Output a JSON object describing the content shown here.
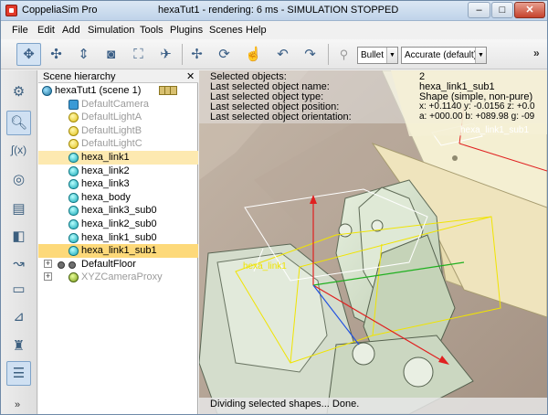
{
  "window": {
    "app_name": "CoppeliaSim Pro",
    "title": "hexaTut1 - rendering: 6 ms - SIMULATION STOPPED",
    "min_label": "–",
    "max_label": "□",
    "close_label": "✕"
  },
  "menu": [
    "File",
    "Edit",
    "Add",
    "Simulation",
    "Tools",
    "Plugins",
    "Scenes",
    "Help"
  ],
  "toolbar": {
    "engine": "Bullet",
    "accuracy": "Accurate (default)",
    "more": "»"
  },
  "left_toolbar": {
    "more": "»"
  },
  "hierarchy": {
    "title": "Scene hierarchy",
    "close": "✕",
    "rows": [
      {
        "label": "hexaTut1 (scene 1)",
        "icon": "world-icon",
        "dim": false
      },
      {
        "label": "DefaultCamera",
        "icon": "camera-icon",
        "dim": true
      },
      {
        "label": "DefaultLightA",
        "icon": "light-icon",
        "dim": true
      },
      {
        "label": "DefaultLightB",
        "icon": "light-icon",
        "dim": true
      },
      {
        "label": "DefaultLightC",
        "icon": "light-icon",
        "dim": true
      },
      {
        "label": "hexa_link1",
        "icon": "shape-icon",
        "dim": false,
        "selected": "secondary"
      },
      {
        "label": "hexa_link2",
        "icon": "shape-icon",
        "dim": false
      },
      {
        "label": "hexa_link3",
        "icon": "shape-icon",
        "dim": false
      },
      {
        "label": "hexa_body",
        "icon": "shape-icon",
        "dim": false
      },
      {
        "label": "hexa_link3_sub0",
        "icon": "shape-icon",
        "dim": false
      },
      {
        "label": "hexa_link2_sub0",
        "icon": "shape-icon",
        "dim": false
      },
      {
        "label": "hexa_link1_sub0",
        "icon": "shape-icon",
        "dim": false
      },
      {
        "label": "hexa_link1_sub1",
        "icon": "shape-icon",
        "dim": false,
        "selected": "primary"
      },
      {
        "label": "DefaultFloor",
        "icon": "floor-icon",
        "dim": false
      },
      {
        "label": "XYZCameraProxy",
        "icon": "proxy-icon",
        "dim": true
      }
    ]
  },
  "info": {
    "labels": [
      "Selected objects:",
      "Last selected object name:",
      "Last selected object type:",
      "Last selected object position:",
      "Last selected object orientation:"
    ],
    "values": [
      "2",
      "hexa_link1_sub1",
      "Shape (simple, non-pure)",
      "x: +0.1140    y: -0.0156    z: +0.0",
      "a: +000.00    b: +089.98    g: -09"
    ]
  },
  "viewport_labels": {
    "link1_sub1": "hexa_link1_sub1",
    "link1": "hexa_link1"
  },
  "status": "Dividing selected shapes... Done."
}
